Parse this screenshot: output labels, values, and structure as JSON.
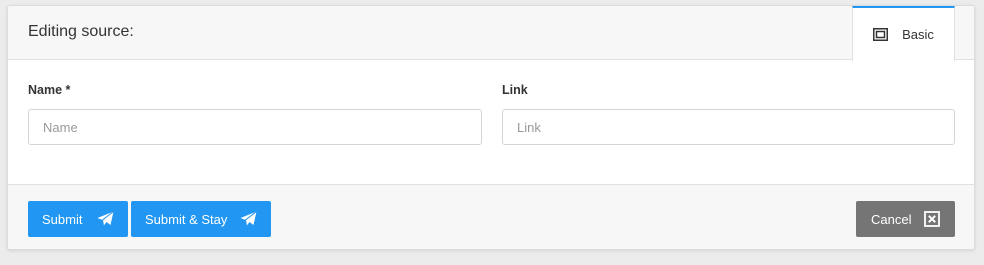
{
  "header": {
    "title": "Editing source:",
    "tabs": [
      {
        "label": "Basic",
        "icon": "expand-icon",
        "active": true
      }
    ]
  },
  "form": {
    "name": {
      "label": "Name *",
      "placeholder": "Name",
      "value": ""
    },
    "link": {
      "label": "Link",
      "placeholder": "Link",
      "value": ""
    }
  },
  "footer": {
    "submit_label": "Submit",
    "submit_icon": "paper-plane-icon",
    "submit_stay_label": "Submit & Stay",
    "submit_stay_icon": "paper-plane-icon",
    "cancel_label": "Cancel",
    "cancel_icon": "close-box-icon"
  },
  "colors": {
    "accent": "#2196f3",
    "cancel": "#757575",
    "background": "#ececec"
  }
}
